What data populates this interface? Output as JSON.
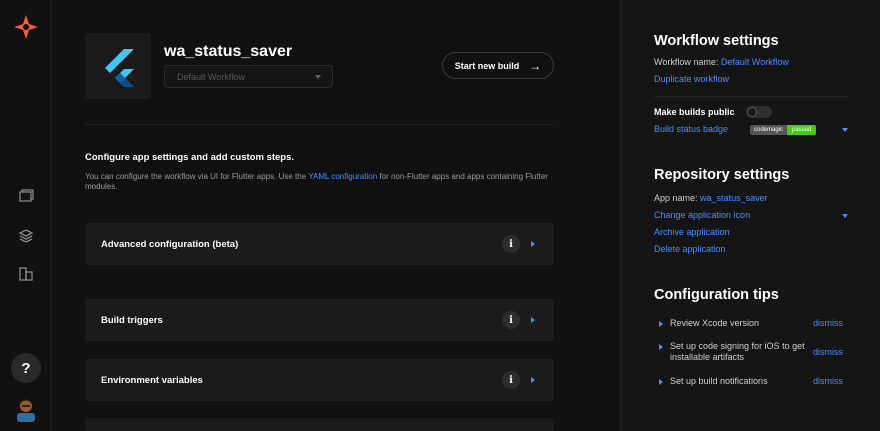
{
  "app": {
    "name": "wa_status_saver",
    "workflow_placeholder": "Default Workflow",
    "start_build_label": "Start new build",
    "start_build_arrow": "→"
  },
  "nav": {
    "help_label": "?"
  },
  "config": {
    "title": "Configure app settings and add custom steps.",
    "desc_before": "You can configure the workflow via UI for Flutter apps. Use the ",
    "desc_link": "YAML configuration",
    "desc_after": " for non-Flutter apps and apps containing Flutter modules.",
    "sections": [
      {
        "label": "Advanced configuration (beta)"
      },
      {
        "label": "Build triggers"
      },
      {
        "label": "Environment variables"
      }
    ],
    "info_glyph": "i"
  },
  "workflow_settings": {
    "heading": "Workflow settings",
    "name_label": "Workflow name:",
    "name_value": "Default Workflow",
    "duplicate_link": "Duplicate workflow",
    "make_public_label": "Make builds public",
    "status_badge_link": "Build status badge",
    "badge_left": "codemagic",
    "badge_right": "passed"
  },
  "repository_settings": {
    "heading": "Repository settings",
    "app_name_label": "App name:",
    "app_name_value": "wa_status_saver",
    "change_icon_link": "Change application icon",
    "archive_link": "Archive application",
    "delete_link": "Delete application"
  },
  "tips": {
    "heading": "Configuration tips",
    "dismiss_label": "dismiss",
    "items": [
      {
        "text": "Review Xcode version"
      },
      {
        "text": "Set up code signing for iOS to get installable artifacts"
      },
      {
        "text": "Set up build notifications"
      }
    ]
  },
  "colors": {
    "accent": "#4a8dff",
    "brand_orange": "#f45d3a",
    "flutter_blue": "#44c5f4",
    "badge_green": "#44cc11"
  }
}
